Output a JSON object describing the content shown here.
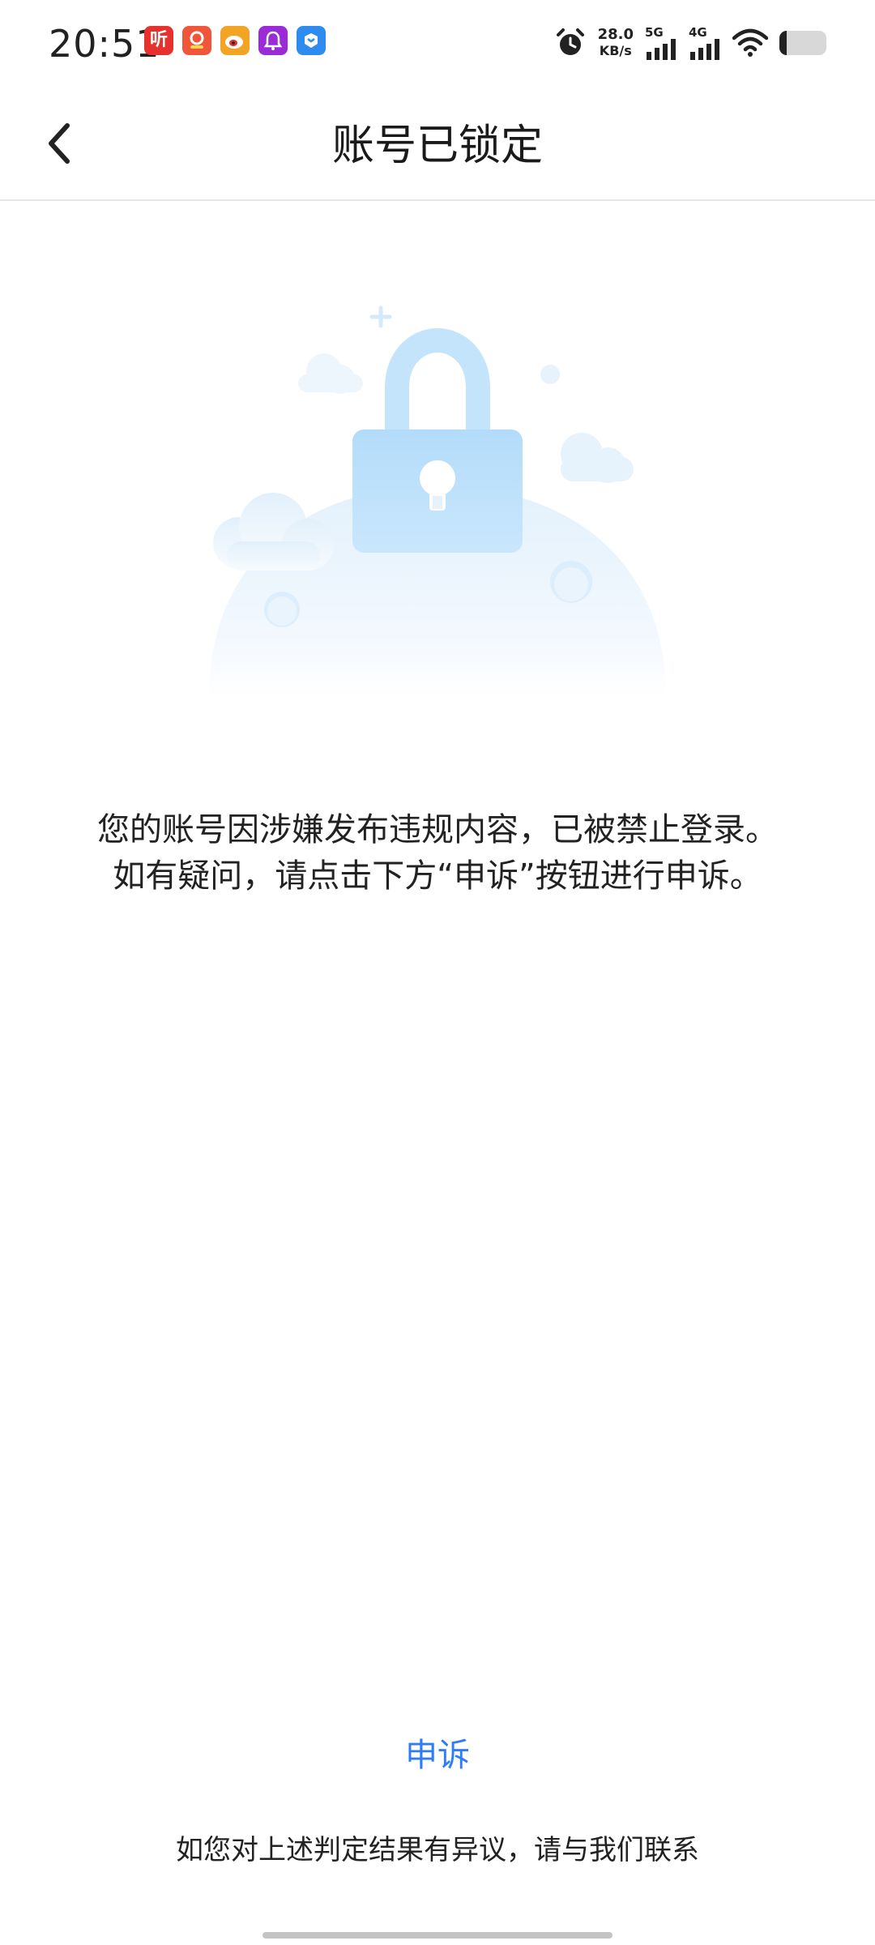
{
  "status_bar": {
    "time": "20:51",
    "notification_apps": [
      {
        "name": "ting-app-icon",
        "glyph": "听",
        "color": "#e5322d"
      },
      {
        "name": "pinduoduo-app-icon",
        "glyph": "多",
        "color": "#f0573a"
      },
      {
        "name": "weibo-app-icon",
        "glyph": "微",
        "color": "#f4a425"
      },
      {
        "name": "bell-app-icon",
        "glyph": "🔔",
        "color": "#9a2bd6"
      },
      {
        "name": "store-app-icon",
        "glyph": "◆",
        "color": "#2e8cf0"
      }
    ],
    "net_speed_value": "28.0",
    "net_speed_unit": "KB/s",
    "signal_1_label": "5G",
    "signal_2_label": "4G",
    "battery_level": 0.15
  },
  "nav": {
    "title": "账号已锁定"
  },
  "message": {
    "line1": "您的账号因涉嫌发布违规内容，已被禁止登录。",
    "line2": "如有疑问，请点击下方“申诉”按钮进行申诉。"
  },
  "actions": {
    "appeal_label": "申诉",
    "contact_text": "如您对上述判定结果有异议，请与我们联系"
  },
  "colors": {
    "accent": "#2f7cf6",
    "lock": "#bfe2fb"
  }
}
